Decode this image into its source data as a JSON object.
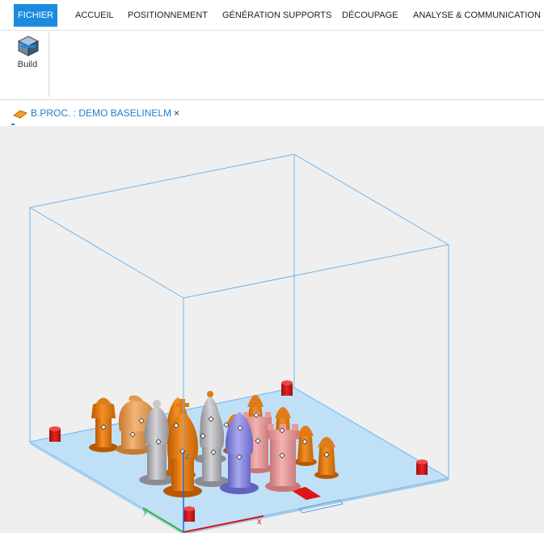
{
  "menu": {
    "tabs": [
      {
        "label": "FICHIER",
        "active": true
      },
      {
        "label": "ACCUEIL"
      },
      {
        "label": "POSITIONNEMENT"
      },
      {
        "label": "GÉNÉRATION SUPPORTS"
      },
      {
        "label": "DÉCOUPAGE"
      },
      {
        "label": "ANALYSE & COMMUNICATION"
      }
    ]
  },
  "ribbon": {
    "build_label": "Build"
  },
  "document_tab": {
    "title": "B.PROC. : DEMO BASELINELM",
    "close": "×"
  },
  "viewport": {
    "axis_labels": {
      "x": "x",
      "y": "y",
      "z": "z"
    },
    "colors": {
      "background": "#efefef",
      "box_edges": "#6fb4ec",
      "build_plate": "#bfe0f7",
      "orange": "#ea7a12",
      "tan": "#eda55a",
      "gray": "#b4b4b8",
      "lavender": "#8e8ee0",
      "pink": "#e99a9a",
      "marker_red": "#d81717"
    }
  }
}
